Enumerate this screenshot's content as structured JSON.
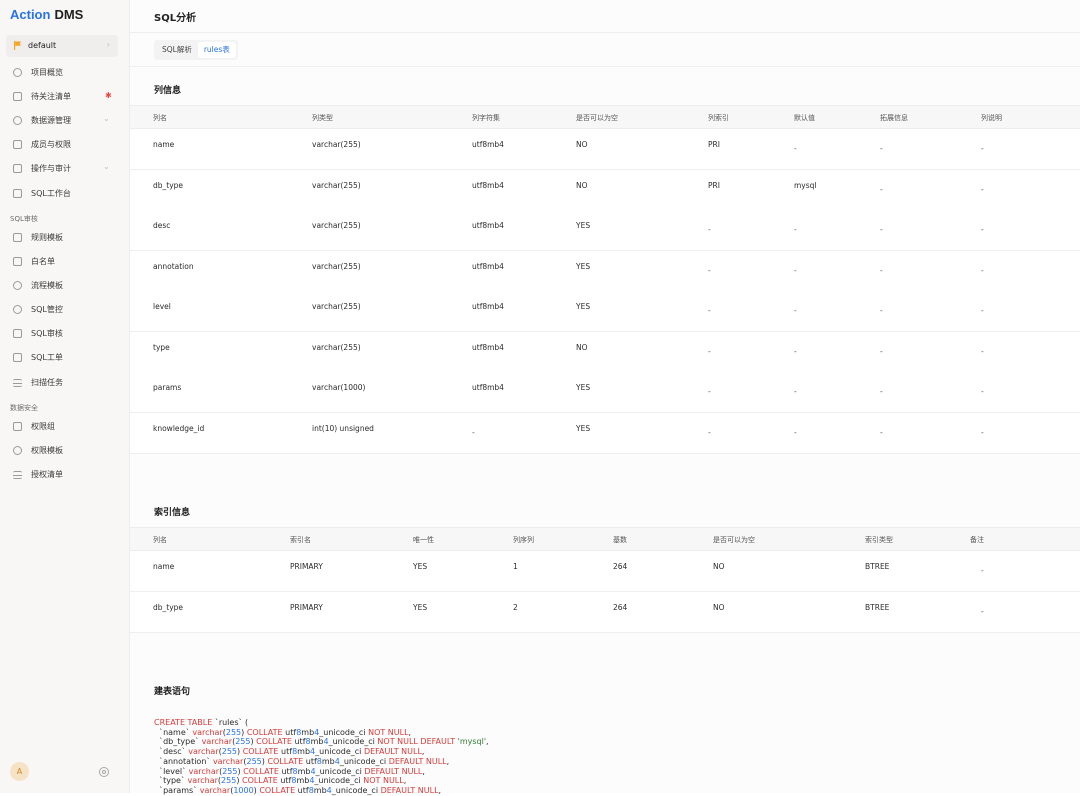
{
  "brand": {
    "part1": "Action",
    "part2": "DMS"
  },
  "project": {
    "name": "default"
  },
  "nav": [
    {
      "label": "项目概览",
      "icon": "overview-icon"
    },
    {
      "label": "待关注清单",
      "icon": "watchlist-icon",
      "badge": true
    },
    {
      "label": "数据源管理",
      "icon": "datasource-icon",
      "expandable": true
    },
    {
      "label": "成员与权限",
      "icon": "members-icon"
    },
    {
      "label": "操作与审计",
      "icon": "audit-icon",
      "expandable": true
    },
    {
      "label": "SQL工作台",
      "icon": "workbench-icon"
    }
  ],
  "sections": [
    {
      "title": "SQL审核",
      "items": [
        {
          "label": "规则模板",
          "icon": "rule-template-icon"
        },
        {
          "label": "白名单",
          "icon": "whitelist-icon"
        },
        {
          "label": "流程模板",
          "icon": "workflow-icon"
        },
        {
          "label": "SQL管控",
          "icon": "sql-control-icon"
        },
        {
          "label": "SQL审核",
          "icon": "sql-audit-icon"
        },
        {
          "label": "SQL工单",
          "icon": "sql-ticket-icon"
        },
        {
          "label": "扫描任务",
          "icon": "scan-task-icon"
        }
      ]
    },
    {
      "title": "数据安全",
      "items": [
        {
          "label": "权限组",
          "icon": "lock-icon"
        },
        {
          "label": "权限模板",
          "icon": "shield-icon"
        },
        {
          "label": "授权清单",
          "icon": "key-icon"
        }
      ]
    }
  ],
  "user": {
    "avatar": "A"
  },
  "page": {
    "title": "SQL分析"
  },
  "tabs": [
    {
      "label": "SQL解析",
      "active": false
    },
    {
      "label": "rules表",
      "active": true
    }
  ],
  "columns_section": {
    "title": "列信息",
    "headers": [
      "列名",
      "列类型",
      "列字符集",
      "是否可以为空",
      "列索引",
      "默认值",
      "拓展信息",
      "列说明"
    ],
    "rows": [
      [
        "name",
        "varchar(255)",
        "utf8mb4",
        "NO",
        "PRI",
        "-",
        "-",
        "-"
      ],
      [
        "db_type",
        "varchar(255)",
        "utf8mb4",
        "NO",
        "PRI",
        "mysql",
        "-",
        "-"
      ],
      [
        "desc",
        "varchar(255)",
        "utf8mb4",
        "YES",
        "-",
        "-",
        "-",
        "-"
      ],
      [
        "annotation",
        "varchar(255)",
        "utf8mb4",
        "YES",
        "-",
        "-",
        "-",
        "-"
      ],
      [
        "level",
        "varchar(255)",
        "utf8mb4",
        "YES",
        "-",
        "-",
        "-",
        "-"
      ],
      [
        "type",
        "varchar(255)",
        "utf8mb4",
        "NO",
        "-",
        "-",
        "-",
        "-"
      ],
      [
        "params",
        "varchar(1000)",
        "utf8mb4",
        "YES",
        "-",
        "-",
        "-",
        "-"
      ],
      [
        "knowledge_id",
        "int(10) unsigned",
        "-",
        "YES",
        "-",
        "-",
        "-",
        "-"
      ]
    ]
  },
  "index_section": {
    "title": "索引信息",
    "headers": [
      "列名",
      "索引名",
      "唯一性",
      "列序列",
      "基数",
      "是否可以为空",
      "索引类型",
      "备注"
    ],
    "rows": [
      [
        "name",
        "PRIMARY",
        "YES",
        "1",
        "264",
        "NO",
        "BTREE",
        "-"
      ],
      [
        "db_type",
        "PRIMARY",
        "YES",
        "2",
        "264",
        "NO",
        "BTREE",
        "-"
      ]
    ]
  },
  "ddl_section": {
    "title": "建表语句",
    "lines": [
      "CREATE TABLE `rules` (",
      "  `name` varchar(255) COLLATE utf8mb4_unicode_ci NOT NULL,",
      "  `db_type` varchar(255) COLLATE utf8mb4_unicode_ci NOT NULL DEFAULT 'mysql',",
      "  `desc` varchar(255) COLLATE utf8mb4_unicode_ci DEFAULT NULL,",
      "  `annotation` varchar(255) COLLATE utf8mb4_unicode_ci DEFAULT NULL,",
      "  `level` varchar(255) COLLATE utf8mb4_unicode_ci DEFAULT NULL,",
      "  `type` varchar(255) COLLATE utf8mb4_unicode_ci NOT NULL,",
      "  `params` varchar(1000) COLLATE utf8mb4_unicode_ci DEFAULT NULL,"
    ]
  },
  "colors": {
    "accent": "#2873e8",
    "keyword": "#d63b3b",
    "badge": "#e8453c",
    "flag": "#f5a623"
  }
}
